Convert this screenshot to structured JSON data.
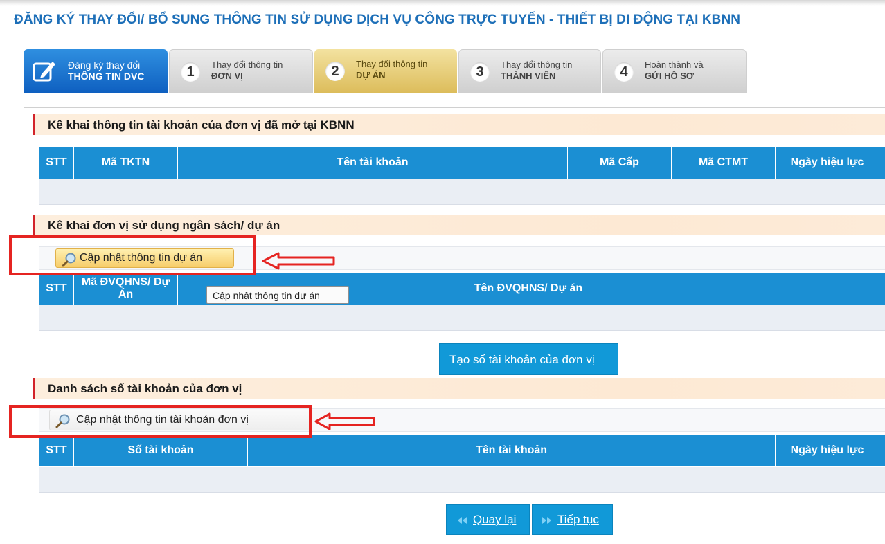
{
  "page_title": "ĐĂNG KÝ THAY ĐỔI/ BỔ SUNG THÔNG TIN SỬ DỤNG DỊCH VỤ CÔNG TRỰC TUYẾN - THIẾT BỊ DI ĐỘNG TẠI KBNN",
  "tabs": [
    {
      "line1": "Đăng ký thay đổi",
      "line2": "THÔNG TIN DVC",
      "icon": "edit-icon",
      "state": "active"
    },
    {
      "number": "1",
      "line1": "Thay đổi thông tin",
      "line2": "ĐƠN VỊ",
      "state": "default"
    },
    {
      "number": "2",
      "line1": "Thay đổi thông tin",
      "line2": "DỰ ÁN",
      "state": "current"
    },
    {
      "number": "3",
      "line1": "Thay đổi thông tin",
      "line2": "THÀNH VIÊN",
      "state": "default"
    },
    {
      "number": "4",
      "line1": "Hoàn thành và",
      "line2": "GỬI HỒ SƠ",
      "state": "default"
    }
  ],
  "sections": {
    "accounts": {
      "title": "Kê khai thông tin tài khoản của đơn vị đã mở tại KBNN",
      "columns": [
        "STT",
        "Mã TKTN",
        "Tên tài khoản",
        "Mã Cấp",
        "Mã CTMT",
        "Ngày hiệu lực"
      ]
    },
    "budget_units": {
      "title": "Kê khai đơn vị sử dụng ngân sách/ dự án",
      "update_button": "Cập nhật thông tin dự án",
      "tooltip": "Cập nhật thông tin dự án",
      "columns": [
        "STT",
        "Mã ĐVQHNS/ Dự Án",
        "Tên ĐVQHNS/ Dự án"
      ]
    },
    "create_account_button": "Tạo số tài khoản của đơn vị",
    "account_list": {
      "title": "Danh sách số tài khoản của đơn vị",
      "update_button": "Cập nhật thông tin tài khoản đơn vị",
      "columns": [
        "STT",
        "Số tài khoản",
        "Tên tài khoản",
        "Ngày hiệu lực"
      ]
    }
  },
  "nav": {
    "back": "Quay lại",
    "next": "Tiếp tục"
  },
  "colors": {
    "title": "#1d6fb8",
    "header": "#1b8fd3",
    "highlight": "#e52421",
    "active_tab": "#0e5fc0",
    "current_tab": "#dcbc5a"
  }
}
